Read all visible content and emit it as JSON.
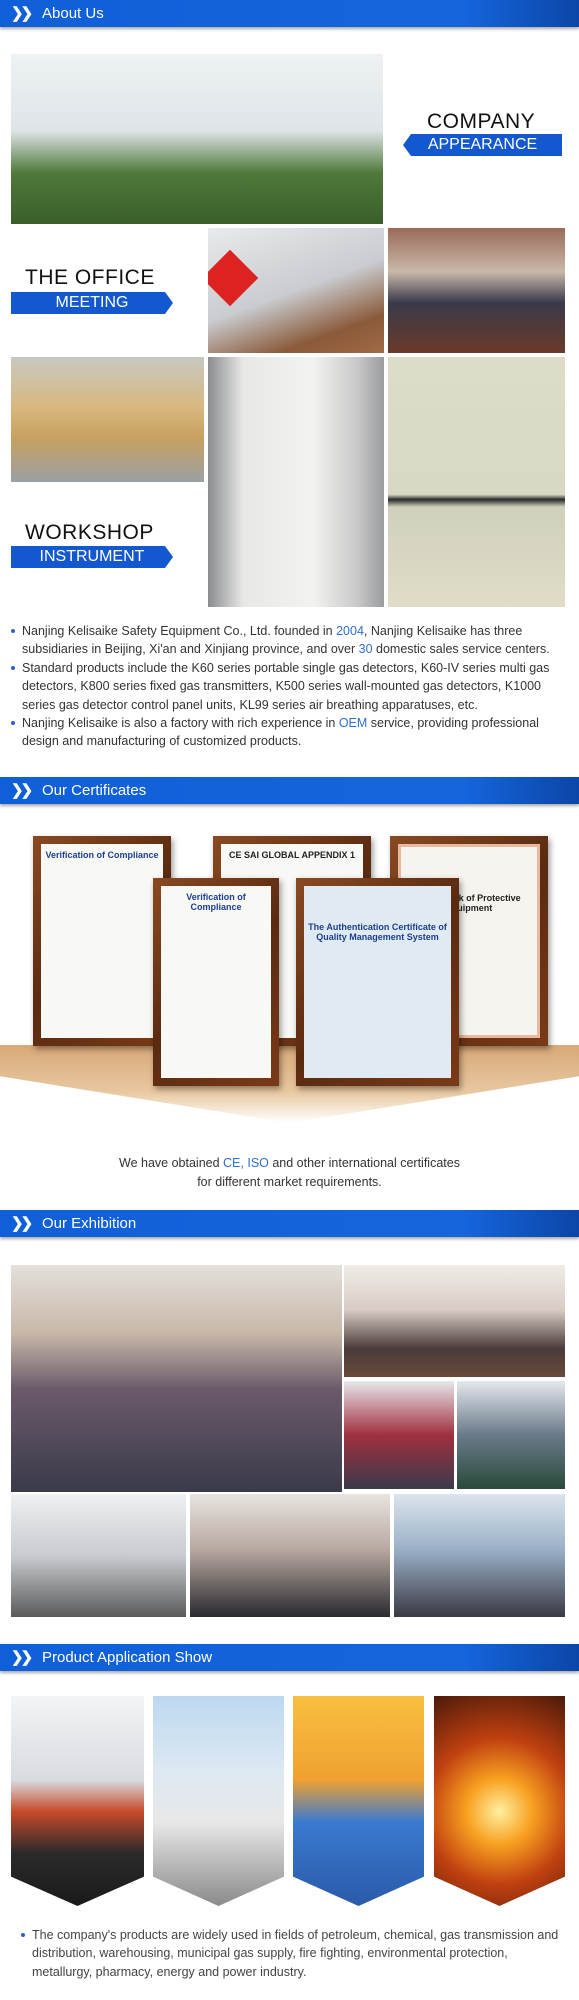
{
  "sections": {
    "about": "About Us",
    "certificates": "Our Certificates",
    "exhibition": "Our Exhibition",
    "application": "Product Application Show"
  },
  "about": {
    "labels": [
      {
        "big": "COMPANY",
        "bar": "APPEARANCE"
      },
      {
        "big": "THE OFFICE",
        "bar": "MEETING"
      },
      {
        "big": "WORKSHOP",
        "bar": "INSTRUMENT"
      }
    ],
    "bullets": [
      {
        "a": "Nanjing Kelisaike Safety Equipment Co., Ltd. founded in ",
        "h1": "2004",
        "b": ", Nanjing Kelisaike has three subsidiaries in Beijing, Xi'an and Xinjiang province, and over ",
        "h2": "30",
        "c": " domestic sales service centers."
      },
      {
        "a": "Standard products include the K60 series portable single gas detectors, K60-IV series multi gas detectors, K800 series fixed gas transmitters, K500 series wall-mounted gas detectors, K1000 series gas detector control panel units, KL99 series air breathing apparatuses, etc."
      },
      {
        "a": "Nanjing Kelisaike is also a factory with rich experience in ",
        "h1": "OEM",
        "b": " service, providing professional design and manufacturing of customized products."
      }
    ]
  },
  "certificates": {
    "frames": [
      "Verification of Compliance",
      "CE SAI GLOBAL APPENDIX 1",
      "of LA Mark of Protective Equipment",
      "Verification of Compliance",
      "The Authentication Certificate of Quality Management System"
    ],
    "text1a": "We have obtained ",
    "text1h": "CE, ISO",
    "text1b": " and other international certificates",
    "text2": "for different market requirements."
  },
  "application": {
    "bullet": "The company's products are widely used in fields of petroleum, chemical, gas transmission and distribution, warehousing, municipal gas supply, fire fighting, environmental protection, metallurgy, pharmacy, energy and power industry."
  },
  "colors": {
    "accent": "#1565dc",
    "highlight": "#2f6fd0"
  }
}
